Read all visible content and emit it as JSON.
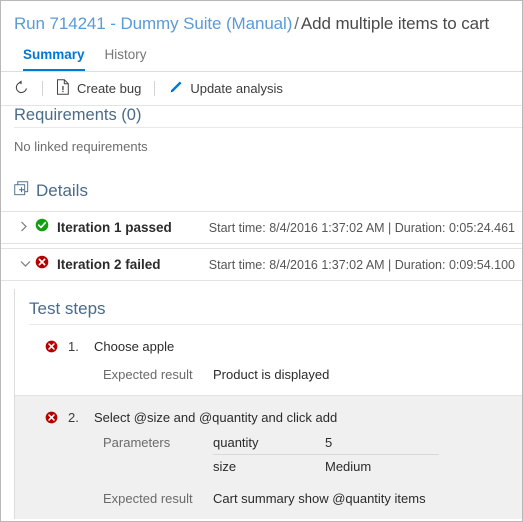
{
  "header": {
    "run_link": "Run 714241 - Dummy Suite (Manual)",
    "separator": "/",
    "current": "Add multiple items to cart"
  },
  "tabs": [
    {
      "label": "Summary",
      "active": true
    },
    {
      "label": "History",
      "active": false
    }
  ],
  "toolbar": {
    "refresh_label": "",
    "refresh_icon": "refresh-icon",
    "create_bug_label": "Create bug",
    "create_bug_icon": "bug-document-icon",
    "update_analysis_label": "Update analysis",
    "update_analysis_icon": "pencil-icon"
  },
  "requirements": {
    "heading": "Requirements (0)",
    "empty_message": "No linked requirements"
  },
  "details": {
    "heading": "Details",
    "expand_icon": "expand-all-icon",
    "iterations": [
      {
        "chevron": "chevron-right-icon",
        "status_icon": "passed-icon",
        "title": "Iteration 1 passed",
        "meta": "Start time: 8/4/2016 1:37:02 AM | Duration: 0:05:24.461",
        "expanded": false
      },
      {
        "chevron": "chevron-down-icon",
        "status_icon": "failed-icon",
        "title": "Iteration 2 failed",
        "meta": "Start time: 8/4/2016 1:37:02 AM | Duration: 0:09:54.100",
        "expanded": true
      }
    ]
  },
  "test_steps": {
    "heading": "Test steps",
    "steps": [
      {
        "status_icon": "failed-icon",
        "number": "1.",
        "action": "Choose apple",
        "expected_label": "Expected result",
        "expected_value": "Product is displayed"
      },
      {
        "status_icon": "failed-icon",
        "number": "2.",
        "action": "Select @size and @quantity and click add",
        "parameters_label": "Parameters",
        "parameters": [
          {
            "name": "quantity",
            "value": "5"
          },
          {
            "name": "size",
            "value": "Medium"
          }
        ],
        "expected_label": "Expected result",
        "expected_value": "Cart summary show @quantity items"
      }
    ]
  },
  "colors": {
    "link_blue": "#5a9bd8",
    "accent_blue": "#0078d7",
    "heading_blue": "#4a6b8a",
    "pass_green": "#107c10",
    "fail_red": "#a80000",
    "alt_row_gray": "#f0f0f0"
  }
}
